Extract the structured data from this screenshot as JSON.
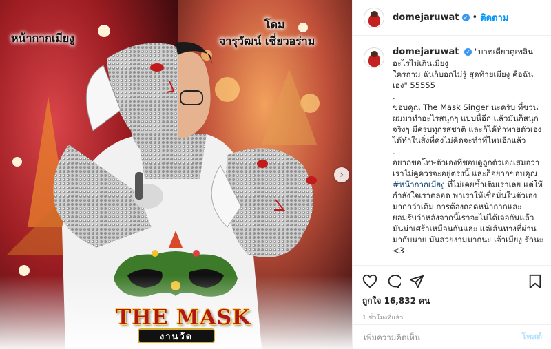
{
  "photo": {
    "overlay_left": "หน้ากากเมียงู",
    "overlay_right_line1": "โดม",
    "overlay_right_line2": "จารุวัฒน์ เชี่ยวอร่าม",
    "logo_title": "THE MASK",
    "logo_sub": "งานวัด",
    "next_icon": "chevron-right-icon"
  },
  "header": {
    "username": "domejaruwat",
    "separator": "•",
    "follow_label": "ติดตาม"
  },
  "caption": {
    "username": "domejaruwat",
    "text_part1": "\"บาทเดียวดูเพลิน อะไรไม่เกินเมียงู\nใครถาม ฉันก็บอกไม่รู้ สุดท้ายเมียงู คือฉันเอง\" 55555\n.\nขอบคุณ The Mask Singer นะครับ ที่ชวนผมมาทำอะไรสนุกๆ แบบนี้อีก แล้วมันก็สนุกจริงๆ มีครบทุกรสชาติ และก็ได้ท้าทายตัวเอง ได้ทำในสิ่งที่คงไม่คิดจะทำที่ไหนอีกแล้ว\n.\nอยากขอโทษตัวเองที่ชอบดูถูกตัวเองเสมอว่าเราไม่คูควรจะอยู่ตรงนี้ และก็อยากขอบคุณ ",
    "hashtag": "#หน้ากากเมียงู",
    "text_part2": " ที่ไม่เคยซ้ำเติมเราเลย แต่ให้กำลังใจเราตลอด พาเราให้เชื่อมั่นในตัวเองมากกว่าเดิม การต้องถอดหน้ากากและยอมรับว่าหลังจากนี้เราจะไม่ได้เจอกันแล้ว มันน่าเศร้าเหมือนกันแฮะ แต่เส้นทางที่ผ่านมากับนาย มันสวยงามมากนะ เจ้าเมียงู รักนะ <3"
  },
  "actions": {
    "likes_label": "ถูกใจ",
    "likes_count": "16,832",
    "likes_unit": "คน",
    "time_ago": "1 ชั่วโมงที่แล้ว"
  },
  "comment": {
    "placeholder": "เพิ่มความคิดเห็น",
    "post_label": "โพสต์"
  },
  "colors": {
    "accent": "#0095f6",
    "verified": "#3897f0",
    "post_disabled": "#b2dffc",
    "background": "#ffffff"
  }
}
